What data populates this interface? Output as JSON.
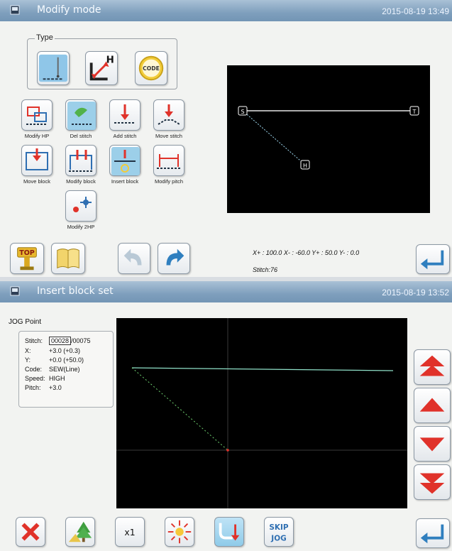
{
  "top_screen": {
    "title": "Modify mode",
    "datetime": "2015-08-19 13:49",
    "type_group_label": "Type",
    "type_buttons": [
      {
        "icon": "needle-stitch-icon",
        "text": ""
      },
      {
        "icon": "home-position-arrow-icon",
        "text": "H"
      },
      {
        "icon": "code-badge-icon",
        "text": "CODE"
      }
    ],
    "tools": [
      {
        "label": "Modify HP",
        "icon": "modify-hp-icon"
      },
      {
        "label": "Del stitch",
        "icon": "delete-stitch-icon"
      },
      {
        "label": "Add stitch",
        "icon": "add-stitch-icon"
      },
      {
        "label": "Move stitch",
        "icon": "move-stitch-icon"
      },
      {
        "label": "Move block",
        "icon": "move-block-icon"
      },
      {
        "label": "Modify block",
        "icon": "modify-block-icon"
      },
      {
        "label": "Insert block",
        "icon": "insert-block-icon"
      },
      {
        "label": "Modify pitch",
        "icon": "modify-pitch-icon"
      },
      {
        "label": "Modify 2HP",
        "icon": "modify-2hp-icon"
      }
    ],
    "markers": {
      "start": "S",
      "end": "T",
      "home": "H"
    },
    "coords": {
      "x_plus": "X+ : 100.0",
      "x_minus": "X- : -60.0",
      "y_plus": "Y+ : 50.0",
      "y_minus": "Y- : 0.0"
    },
    "stitch_line": "Stitch:76",
    "bottom_buttons": {
      "top_label": "TOP",
      "book": "book-icon",
      "undo": "undo-icon",
      "redo": "redo-icon",
      "enter": "enter-icon"
    }
  },
  "bottom_screen": {
    "title": "Insert block set",
    "datetime": "2015-08-19 13:52",
    "panel_title": "JOG Point",
    "info": {
      "stitch_label": "Stitch:",
      "stitch_current": "00028",
      "stitch_total": "/00075",
      "x_label": "X:",
      "x_value": "+3.0 (+0.3)",
      "y_label": "Y:",
      "y_value": "+0.0 (+50.0)",
      "code_label": "Code:",
      "code_value": "SEW(Line)",
      "speed_label": "Speed:",
      "speed_value": "HIGH",
      "pitch_label": "Pitch:",
      "pitch_value": "+3.0"
    },
    "scroll_buttons": [
      "fast-up-icon",
      "up-icon",
      "down-icon",
      "fast-down-icon"
    ],
    "toolbar": {
      "cancel": "cancel-x-icon",
      "scenery": "scenery-tree-icon",
      "zoom_label": "x1",
      "center": "center-burst-icon",
      "needle_down": "needle-down-icon",
      "skip_jog_line1": "SKIP",
      "skip_jog_line2": "JOG",
      "enter": "enter-icon"
    }
  },
  "colors": {
    "titlebar": "#7f9fbd",
    "canvas_bg": "#000000",
    "accent_red": "#e0322a",
    "accent_blue": "#2f7fbf"
  }
}
